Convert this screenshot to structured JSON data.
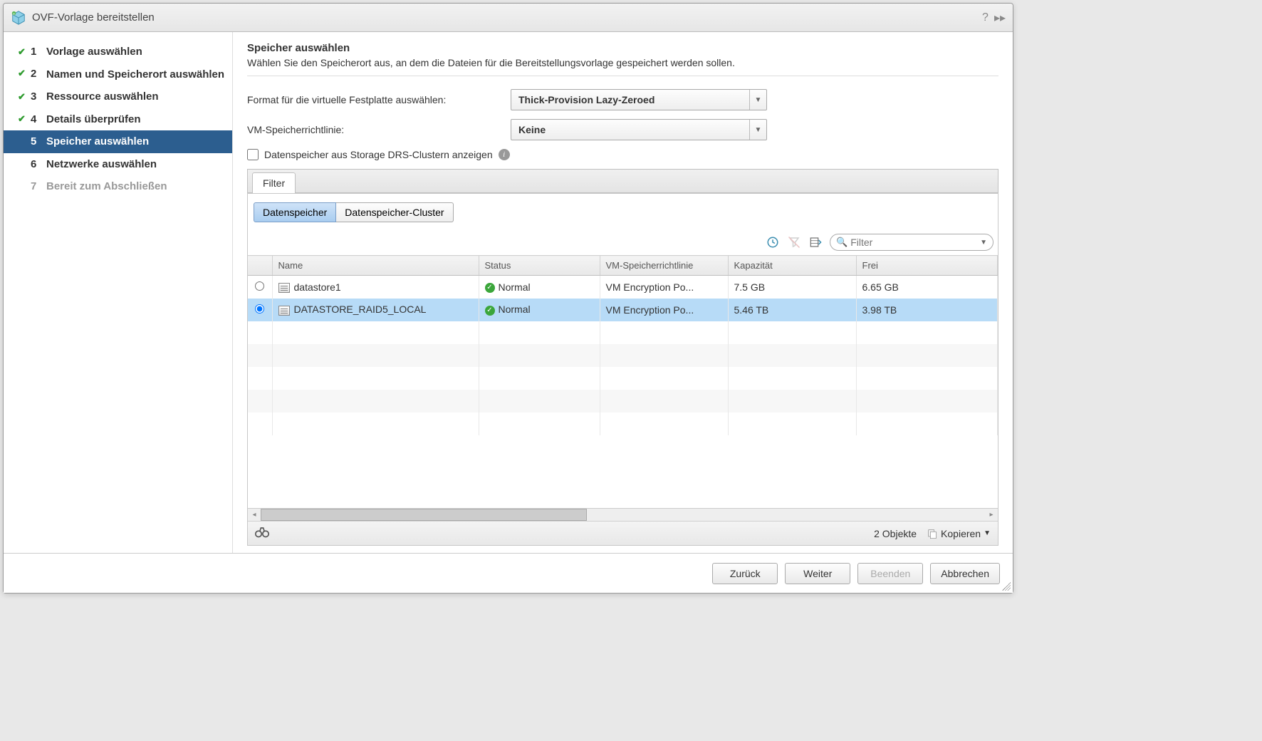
{
  "dialog": {
    "title": "OVF-Vorlage bereitstellen"
  },
  "steps": [
    {
      "num": "1",
      "label": "Vorlage auswählen",
      "done": true
    },
    {
      "num": "2",
      "label": "Namen und Speicherort auswählen",
      "done": true
    },
    {
      "num": "3",
      "label": "Ressource auswählen",
      "done": true
    },
    {
      "num": "4",
      "label": "Details überprüfen",
      "done": true
    },
    {
      "num": "5",
      "label": "Speicher auswählen",
      "active": true
    },
    {
      "num": "6",
      "label": "Netzwerke auswählen"
    },
    {
      "num": "7",
      "label": "Bereit zum Abschließen",
      "disabled": true
    }
  ],
  "main": {
    "heading": "Speicher auswählen",
    "desc": "Wählen Sie den Speicherort aus, an dem die Dateien für die Bereitstellungsvorlage gespeichert werden sollen.",
    "diskformat_label": "Format für die virtuelle Festplatte auswählen:",
    "diskformat_value": "Thick-Provision Lazy-Zeroed",
    "policy_label": "VM-Speicherrichtlinie:",
    "policy_value": "Keine",
    "drs_checkbox": "Datenspeicher aus Storage DRS-Clustern anzeigen",
    "filter_tab": "Filter",
    "subtab1": "Datenspeicher",
    "subtab2": "Datenspeicher-Cluster",
    "search_placeholder": "Filter"
  },
  "table": {
    "headers": {
      "name": "Name",
      "status": "Status",
      "policy": "VM-Speicherrichtlinie",
      "capacity": "Kapazität",
      "free": "Frei"
    },
    "rows": [
      {
        "selected": false,
        "name": "datastore1",
        "status": "Normal",
        "policy": "VM Encryption Po...",
        "capacity": "7.5  GB",
        "free": "6.65  GB"
      },
      {
        "selected": true,
        "name": "DATASTORE_RAID5_LOCAL",
        "status": "Normal",
        "policy": "VM Encryption Po...",
        "capacity": "5.46  TB",
        "free": "3.98  TB"
      }
    ],
    "footer": {
      "count": "2 Objekte",
      "copy": "Kopieren"
    }
  },
  "footer": {
    "back": "Zurück",
    "next": "Weiter",
    "finish": "Beenden",
    "cancel": "Abbrechen"
  }
}
